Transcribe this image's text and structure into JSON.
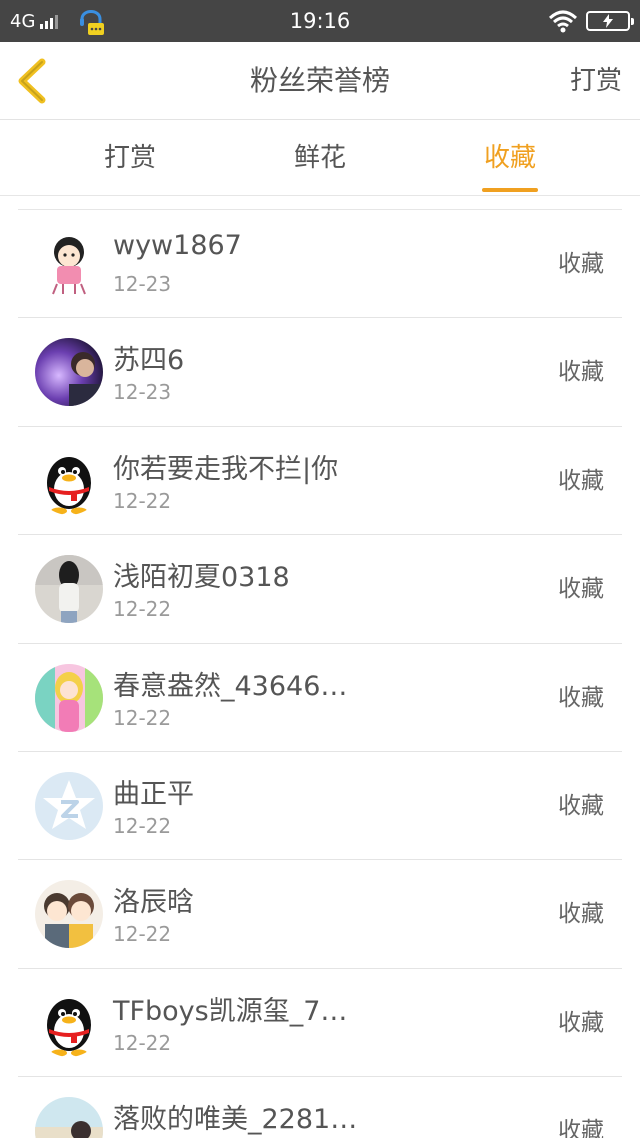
{
  "status_bar": {
    "network": "4G",
    "time": "19:16"
  },
  "header": {
    "title": "粉丝荣誉榜",
    "right_action": "打赏"
  },
  "tabs": [
    {
      "label": "打赏",
      "active": false
    },
    {
      "label": "鲜花",
      "active": false
    },
    {
      "label": "收藏",
      "active": true
    }
  ],
  "colors": {
    "accent": "#f0a020",
    "status_bar": "#454545"
  },
  "fans": [
    {
      "name": "wyw1867",
      "date": "12-23",
      "action": "收藏",
      "avatar": "cartoon-girl-avatar"
    },
    {
      "name": "苏四6",
      "date": "12-23",
      "action": "收藏",
      "avatar": "photo-avatar"
    },
    {
      "name": "你若要走我不拦|你",
      "date": "12-22",
      "action": "收藏",
      "avatar": "qq-penguin-avatar"
    },
    {
      "name": "浅陌初夏0318",
      "date": "12-22",
      "action": "收藏",
      "avatar": "photo-avatar"
    },
    {
      "name": "春意盎然_43646…",
      "date": "12-22",
      "action": "收藏",
      "avatar": "anime-doll-avatar"
    },
    {
      "name": "曲正平",
      "date": "12-22",
      "action": "收藏",
      "avatar": "qzone-star-avatar"
    },
    {
      "name": "洛辰晗",
      "date": "12-22",
      "action": "收藏",
      "avatar": "cartoon-couple-avatar"
    },
    {
      "name": "TFboys凯源玺_7…",
      "date": "12-22",
      "action": "收藏",
      "avatar": "qq-penguin-avatar"
    },
    {
      "name": "落败的唯美_2281…",
      "date": "",
      "action": "收藏",
      "avatar": "photo-avatar"
    }
  ]
}
